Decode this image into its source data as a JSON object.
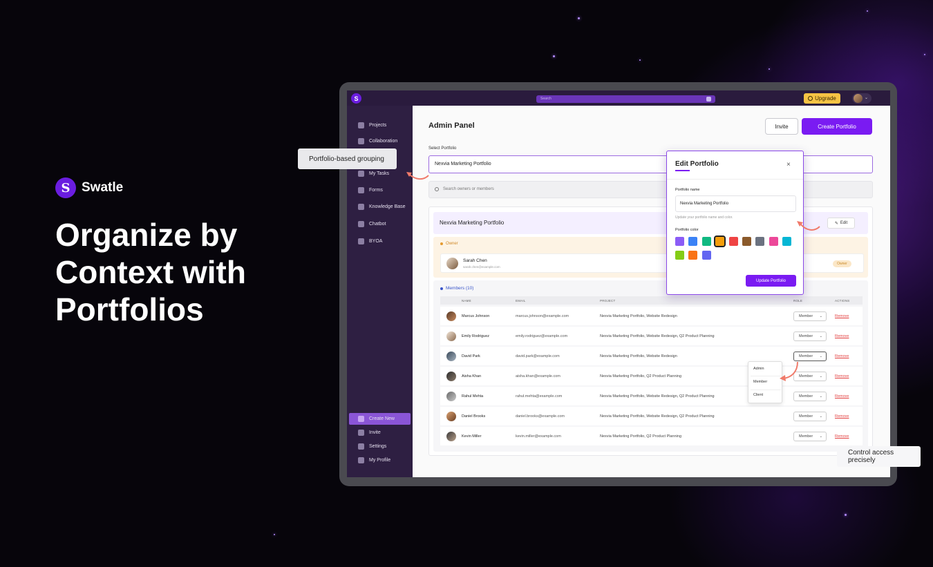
{
  "hero": {
    "brand_name": "Swatle",
    "brand_logo_glyph": "S",
    "title": "Organize by Context with Portfolios"
  },
  "callouts": {
    "grouping": "Portfolio-based grouping",
    "access": "Control access precisely"
  },
  "topbar": {
    "search_placeholder": "Search",
    "upgrade_label": "Upgrade",
    "logo_glyph": "S"
  },
  "sidebar": {
    "items": [
      {
        "label": "Projects",
        "icon": "projects-icon"
      },
      {
        "label": "Collaboration",
        "icon": "collaboration-icon"
      },
      {
        "label": "My Tasks",
        "icon": "tasks-icon"
      },
      {
        "label": "Forms",
        "icon": "forms-icon"
      },
      {
        "label": "Knowledge Base",
        "icon": "knowledge-base-icon"
      },
      {
        "label": "Chatbot",
        "icon": "chatbot-icon"
      },
      {
        "label": "BYOA",
        "icon": "byoa-icon"
      }
    ],
    "bottom_items": [
      {
        "label": "Create New",
        "icon": "plus-icon"
      },
      {
        "label": "Invite",
        "icon": "invite-icon"
      },
      {
        "label": "Settings",
        "icon": "settings-icon"
      },
      {
        "label": "My Profile",
        "icon": "profile-icon"
      }
    ]
  },
  "main": {
    "title": "Admin Panel",
    "invite_label": "Invite",
    "create_label": "Create Portfolio",
    "select_label": "Select Portfolio",
    "selected_portfolio": "Nexvia Marketing Portfolio",
    "search_placeholder": "Search owners or members",
    "portfolio_name": "Nexvia Marketing Portfolio",
    "edit_label": "Edit"
  },
  "owner": {
    "section_label": "Owner",
    "name": "Sarah Chen",
    "email": "sarah.chen@example.com",
    "badge": "Owner"
  },
  "members": {
    "section_label": "Members (10)",
    "headers": {
      "name": "NAME",
      "email": "EMAIL",
      "project": "PROJECT",
      "role": "ROLE",
      "actions": "ACTIONS"
    },
    "remove_label": "Remove",
    "rows": [
      {
        "name": "Marcus Johnson",
        "email": "marcus.johnson@example.com",
        "project": "Nexvia Marketing Portfolio, Website Redesign",
        "role": "Member"
      },
      {
        "name": "Emily Rodriguez",
        "email": "emily.rodriguez@example.com",
        "project": "Nexvia Marketing Portfolio, Website Redesign, Q2 Product Planning",
        "role": "Member"
      },
      {
        "name": "David Park",
        "email": "david.park@example.com",
        "project": "Nexvia Marketing Portfolio, Website Redesign",
        "role": "Member"
      },
      {
        "name": "Aisha Khan",
        "email": "aisha.khan@example.com",
        "project": "Nexvia Marketing Portfolio, Q2 Product Planning",
        "role": "Member"
      },
      {
        "name": "Rahul Mehta",
        "email": "rahul.mehta@example.com",
        "project": "Nexvia Marketing Portfolio, Website Redesign, Q2 Product Planning",
        "role": "Member"
      },
      {
        "name": "Daniel Brooks",
        "email": "daniel.brooks@example.com",
        "project": "Nexvia Marketing Portfolio, Website Redesign, Q2 Product Planning",
        "role": "Member"
      },
      {
        "name": "Kevin Miller",
        "email": "kevin.miller@example.com",
        "project": "Nexvia Marketing Portfolio, Q2 Product Planning",
        "role": "Member"
      }
    ],
    "role_options": [
      "Admin",
      "Member",
      "Client"
    ]
  },
  "modal": {
    "title": "Edit Portfolio",
    "close_glyph": "×",
    "name_label": "Portfolio name",
    "name_value": "Nexvia Marketing Portfolio",
    "hint": "Update your portfolio name and color.",
    "color_label": "Portfolio color",
    "colors": [
      "#8b5cf6",
      "#3b82f6",
      "#10b981",
      "#f59e0b",
      "#ef4444",
      "#8b5a2b",
      "#6b7280",
      "#ec4899",
      "#06b6d4",
      "#84cc16",
      "#f97316",
      "#6366f1"
    ],
    "selected_color": "#f59e0b",
    "update_label": "Update Portfolio"
  },
  "colors": {
    "accent": "#7a1bf2",
    "sidebar_bg": "#2e1f42",
    "remove": "#e23b3b",
    "callout_arrow": "#f07a6a"
  }
}
